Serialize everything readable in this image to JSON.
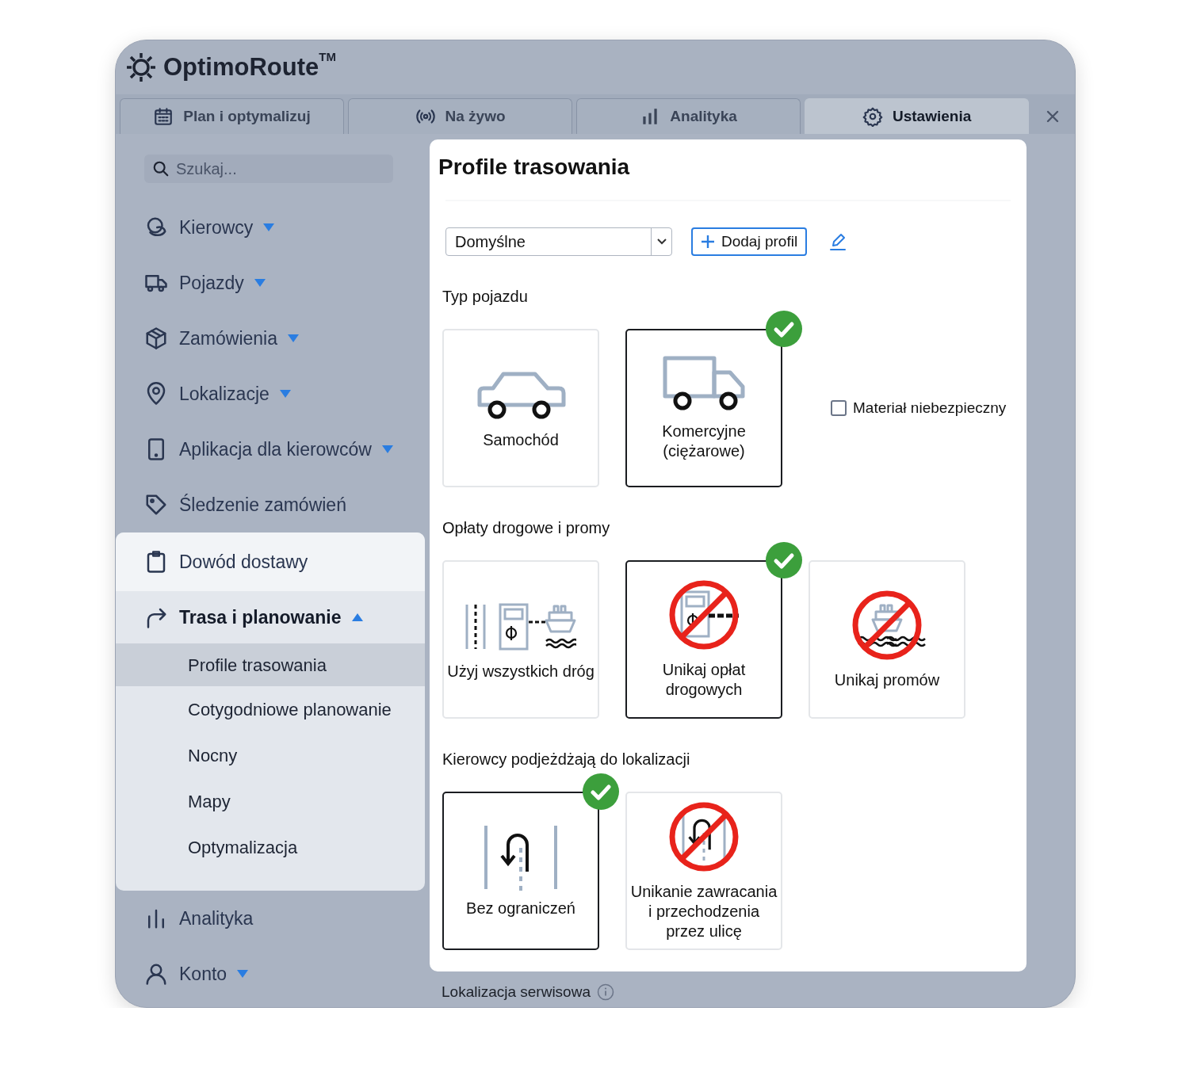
{
  "app": {
    "logo": "OptimoRoute$^{TM}$"
  },
  "tabs": [
    {
      "label": "Plan i optymalizuj",
      "selected": false
    },
    {
      "label": "Na żywo",
      "selected": false
    },
    {
      "label": "Analityka",
      "selected": false
    },
    {
      "label": "Ustawienia",
      "selected": true
    }
  ],
  "sidebar": {
    "search": {
      "placeholder": "Szukaj..."
    },
    "sections": [
      {
        "kind": "plain",
        "items": [
          {
            "label": "Kierowcy",
            "expanded": false
          },
          {
            "label": "Pojazdy",
            "expanded": false
          },
          {
            "label": "Zamówienia",
            "expanded": false
          },
          {
            "label": "Lokalizacje",
            "expanded": false
          },
          {
            "label": "Aplikacja dla kierowców",
            "expanded": false
          },
          {
            "label": "Śledzenie zamówień"
          }
        ]
      },
      {
        "kind": "panel",
        "items": [
          {
            "label": "Dowód dostawy"
          },
          {
            "label": "Trasa i planowanie",
            "expanded": true,
            "children": [
              {
                "label": "Profile trasowania",
                "selected": true
              },
              {
                "label": "Cotygodniowe planowanie",
                "selected": false
              },
              {
                "label": "Nocny",
                "selected": false
              },
              {
                "label": "Mapy",
                "selected": false
              },
              {
                "label": "Optymalizacja",
                "selected": false
              }
            ]
          }
        ]
      },
      {
        "kind": "plain",
        "items": [
          {
            "label": "Analityka"
          },
          {
            "label": "Konto",
            "expanded": false
          }
        ]
      }
    ]
  },
  "content": {
    "title": "Profile trasowania",
    "profile_select": {
      "value": "Domyślne"
    },
    "add_button": "Dodaj profil",
    "sections": [
      {
        "title": "Typ pojazdu",
        "options": [
          {
            "label": "Samochód",
            "selected": false
          },
          {
            "label": "Komercyjne (ciężarowe)",
            "selected": true
          }
        ],
        "checkbox": {
          "label": "Materiał niebezpieczny",
          "checked": false
        }
      },
      {
        "title": "Opłaty drogowe i promy",
        "options": [
          {
            "label": "Użyj wszystkich dróg",
            "selected": false
          },
          {
            "label": "Unikaj opłat drogowych",
            "selected": true
          },
          {
            "label": "Unikaj promów",
            "selected": false
          }
        ]
      },
      {
        "title": "Kierowcy podjeżdżają do lokalizacji",
        "options": [
          {
            "label": "Bez ograniczeń",
            "selected": true
          },
          {
            "label": "Unikanie zawracania i przechodzenia przez ulicę",
            "selected": false
          }
        ]
      }
    ]
  },
  "footer_section": {
    "title": "Lokalizacja serwisowa"
  }
}
